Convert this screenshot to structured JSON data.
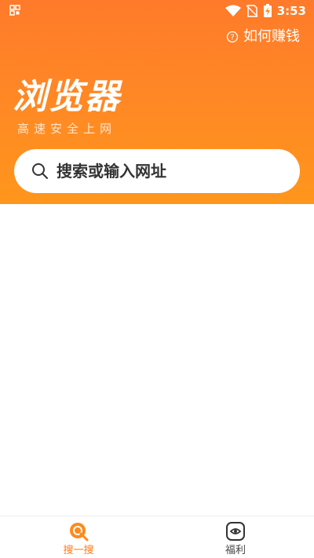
{
  "status_bar": {
    "time": "3:53",
    "icons": [
      "qr-icon",
      "wifi-icon",
      "no-sim-icon",
      "battery-charging-icon"
    ]
  },
  "header": {
    "how_to_earn": "如何赚钱",
    "brand_title": "浏览器",
    "brand_subtitle": "高速安全上网"
  },
  "search": {
    "placeholder": "搜索或输入网址"
  },
  "bottom_nav": {
    "items": [
      {
        "label": "搜一搜",
        "icon": "search-circle-icon",
        "active": true
      },
      {
        "label": "福利",
        "icon": "welfare-icon",
        "active": false
      }
    ]
  },
  "colors": {
    "accent": "#ff7a1a",
    "header_top": "#ff7a2a",
    "header_bottom": "#ff961c"
  }
}
